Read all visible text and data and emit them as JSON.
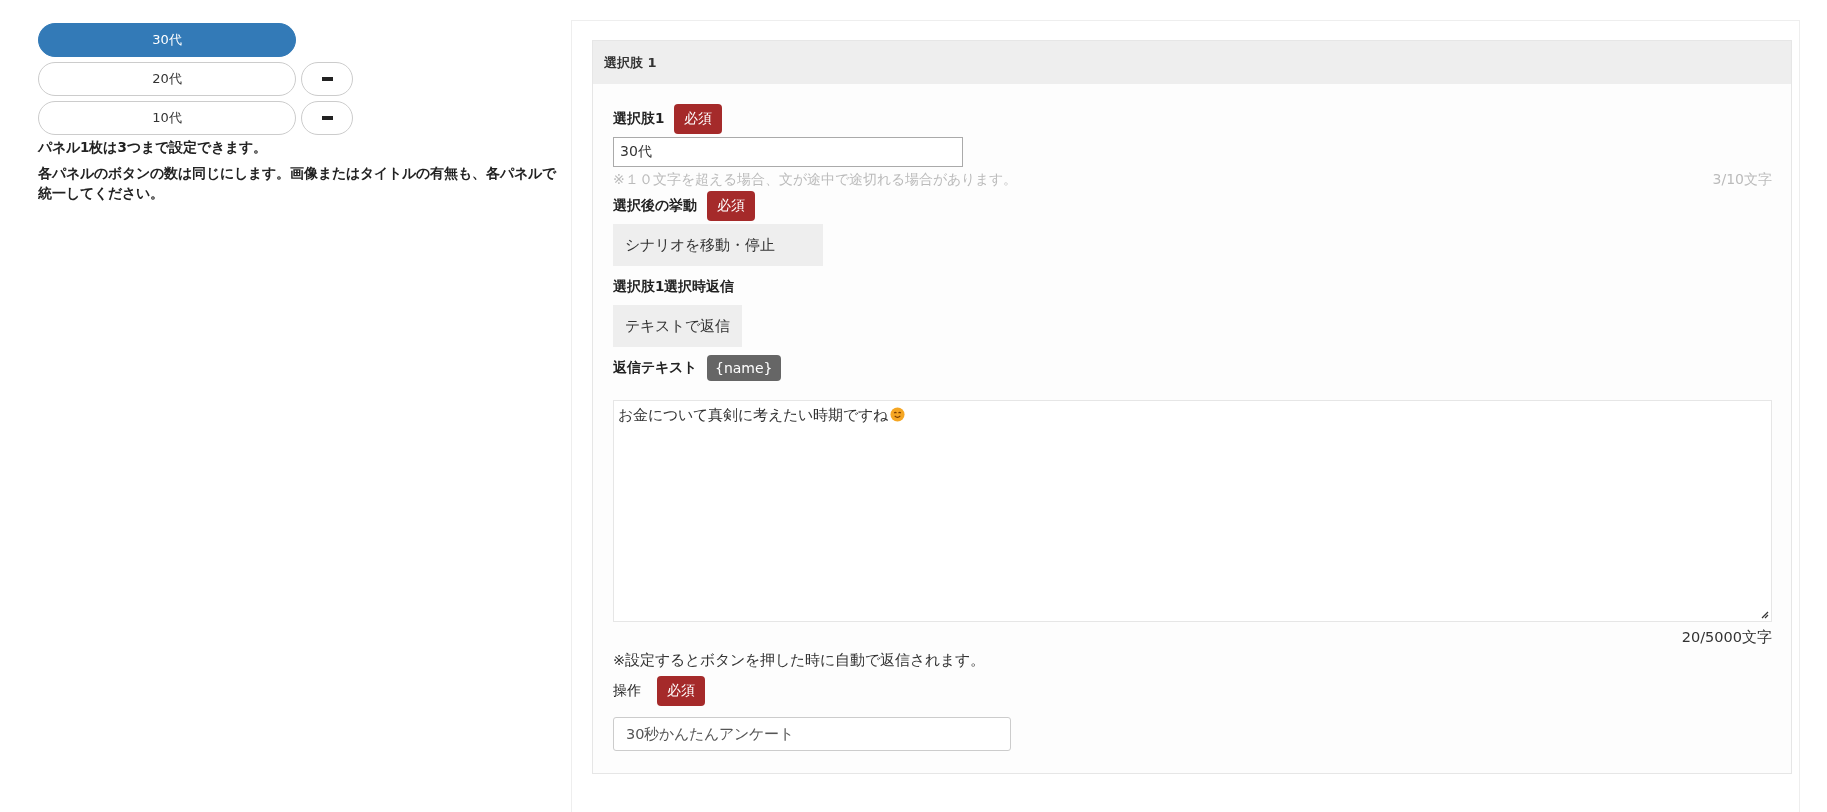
{
  "left_panel": {
    "buttons": [
      {
        "label": "30代",
        "selected": true,
        "removable": false
      },
      {
        "label": "20代",
        "selected": false,
        "removable": true
      },
      {
        "label": "10代",
        "selected": false,
        "removable": true
      }
    ],
    "notes": [
      "パネル1枚は3つまで設定できます。",
      "各パネルのボタンの数は同じにします。画像またはタイトルの有無も、各パネルで統一してください。"
    ]
  },
  "choice_panel": {
    "title": "選択肢 1",
    "choice_label": {
      "label": "選択肢1",
      "required_badge": "必須",
      "value": "30代",
      "hint": "※１０文字を超える場合、文が途中で途切れる場合があります。",
      "counter": "3/10文字"
    },
    "action": {
      "label": "選択後の挙動",
      "required_badge": "必須",
      "value": "シナリオを移動・停止"
    },
    "reply_type": {
      "label": "選択肢1選択時返信",
      "value": "テキストで返信"
    },
    "reply_text": {
      "label": "返信テキスト",
      "insert_button": "{name}",
      "value": "お金について真剣に考えたい時期ですね",
      "counter": "20/5000文字",
      "note": "※設定するとボタンを押した時に自動で返信されます。"
    },
    "operation": {
      "label": "操作",
      "required_badge": "必須",
      "value": "30秒かんたんアンケート"
    }
  }
}
